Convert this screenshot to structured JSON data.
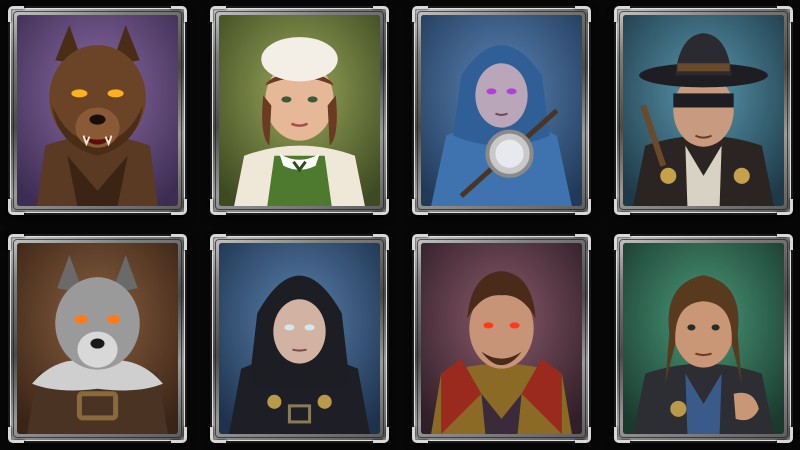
{
  "characters": [
    {
      "id": "werewolf-brown",
      "bg": "#5e4a78",
      "palette": {
        "skin": "#6b4326",
        "hair": "#3d2512",
        "cloth": "#4a2f1c",
        "eye": "#ffb020"
      }
    },
    {
      "id": "village-maid",
      "bg": "#6b7a3a",
      "palette": {
        "skin": "#e6b898",
        "hair": "#6a3b22",
        "cloth": "#4d7a2e",
        "eye": "#3a5a3a"
      }
    },
    {
      "id": "blue-hooded-mage",
      "bg": "#3b5d86",
      "palette": {
        "skin": "#b9a6b8",
        "hair": "#2f5f96",
        "cloth": "#3e73b0",
        "eye": "#b43ce0"
      }
    },
    {
      "id": "hunter-hat",
      "bg": "#3d6f86",
      "palette": {
        "skin": "#c89a80",
        "hair": "#1e1e22",
        "cloth": "#2a2522",
        "eye": "#222222"
      }
    },
    {
      "id": "werewolf-grey",
      "bg": "#5a4030",
      "palette": {
        "skin": "#9a9a9a",
        "hair": "#cfcfcf",
        "cloth": "#4a3322",
        "eye": "#ff7a18"
      }
    },
    {
      "id": "hooded-rogue",
      "bg": "#3a5c84",
      "palette": {
        "skin": "#d2b3a3",
        "hair": "#1d1d24",
        "cloth": "#1e1e26",
        "eye": "#cfe8f0"
      }
    },
    {
      "id": "vampire-noble",
      "bg": "#5b3d4a",
      "palette": {
        "skin": "#c89478",
        "hair": "#4a2a18",
        "cloth": "#8a6a24",
        "eye": "#ff3a1a"
      }
    },
    {
      "id": "ranger-man",
      "bg": "#2f6a56",
      "palette": {
        "skin": "#c99676",
        "hair": "#5a3a1e",
        "cloth": "#2c2e34",
        "eye": "#2a2a2a"
      }
    }
  ]
}
